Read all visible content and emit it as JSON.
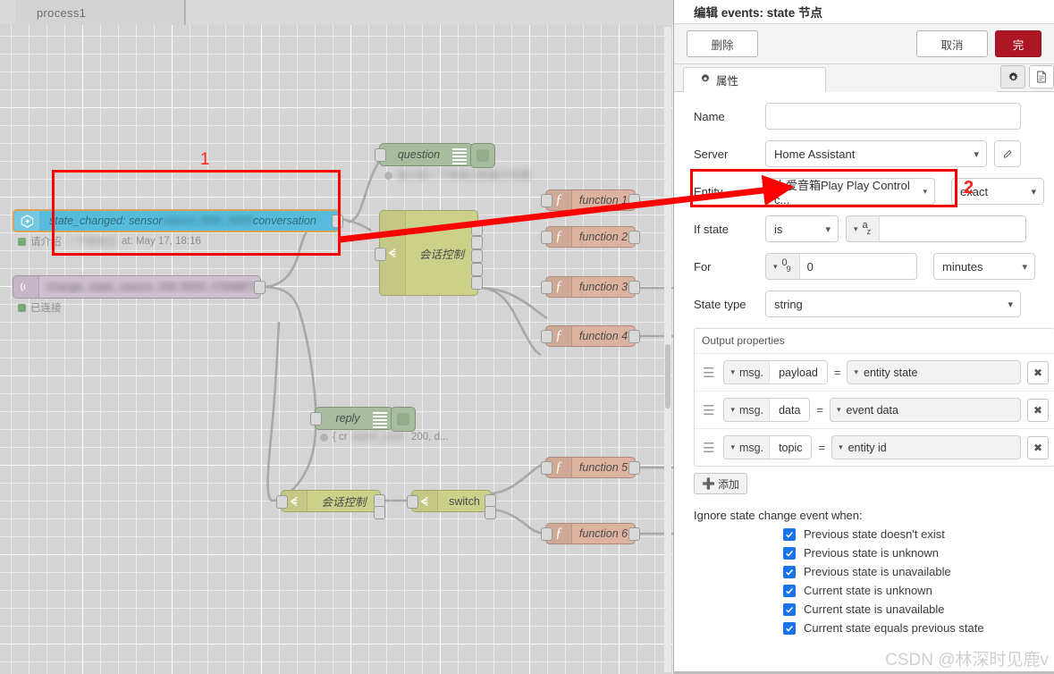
{
  "canvas": {
    "tab_label": "process1",
    "nodes": [
      {
        "id": "state_changed",
        "label": "state_changed: sensor_xiaomi_l05b_5655_conversation",
        "label_visible": "state_changed: sensor",
        "label_tail": "conversation",
        "status": "请介绍",
        "status_tail": "at: May 17, 18:16",
        "type": "events-state",
        "selected": true
      },
      {
        "id": "mqtt_reply",
        "label": "ch...reply",
        "label_tail": "'reply",
        "status": "已连接",
        "type": "mqtt-in"
      },
      {
        "id": "question",
        "label": "question",
        "status": "",
        "type": "ui-template"
      },
      {
        "id": "switch_top",
        "label": "会话控制",
        "type": "switch"
      },
      {
        "id": "reply",
        "label": "reply",
        "status": "{ cr",
        "status_tail": "200, d...",
        "type": "ui-template"
      },
      {
        "id": "switch_bottom",
        "label": "会话控制",
        "type": "switch"
      },
      {
        "id": "switch_mid",
        "label": "switch",
        "type": "switch"
      },
      {
        "id": "function1",
        "label": "function 1",
        "type": "function"
      },
      {
        "id": "function2",
        "label": "function 2",
        "type": "function"
      },
      {
        "id": "function3",
        "label": "function 3",
        "type": "function"
      },
      {
        "id": "function4",
        "label": "function 4",
        "type": "function"
      },
      {
        "id": "function5",
        "label": "function 5",
        "type": "function"
      },
      {
        "id": "function6",
        "label": "function 6",
        "type": "function"
      }
    ]
  },
  "dialog": {
    "title": "编辑 events: state 节点",
    "toolbar": {
      "delete": "删除",
      "cancel": "取消",
      "done": "完"
    },
    "tabs": {
      "properties": "属性",
      "gear_icon": "gear-icon",
      "doc_icon": "document-icon"
    },
    "form": {
      "name_label": "Name",
      "name_value": "",
      "name_placeholder": "",
      "server_label": "Server",
      "server_value": "Home Assistant",
      "entity_label": "Entity",
      "entity_value": "小爱音箱Play Play Control c...",
      "entity_match": "exact",
      "ifstate_label": "If state",
      "ifstate_op": "is",
      "ifstate_type": "az",
      "ifstate_value": "",
      "for_label": "For",
      "for_type": "09",
      "for_value": "0",
      "for_unit": "minutes",
      "statetype_label": "State type",
      "statetype_value": "string"
    },
    "output_properties": {
      "title": "Output properties",
      "rows": [
        {
          "prefix": "msg.",
          "key": "payload",
          "eq": "=",
          "value": "entity state",
          "remove": "✖"
        },
        {
          "prefix": "msg.",
          "key": "data",
          "eq": "=",
          "value": "event data",
          "remove": "✖"
        },
        {
          "prefix": "msg.",
          "key": "topic",
          "eq": "=",
          "value": "entity id",
          "remove": "✖"
        }
      ],
      "add_label": "添加"
    },
    "ignore": {
      "title": "Ignore state change event when:",
      "items": [
        {
          "label": "Previous state doesn't exist",
          "checked": true
        },
        {
          "label": "Previous state is unknown",
          "checked": true
        },
        {
          "label": "Previous state is unavailable",
          "checked": true
        },
        {
          "label": "Current state is unknown",
          "checked": true
        },
        {
          "label": "Current state is unavailable",
          "checked": true
        },
        {
          "label": "Current state equals previous state",
          "checked": true
        }
      ]
    }
  },
  "annotations": {
    "marker_1": "1",
    "marker_2": "2",
    "color": "#ff0000"
  },
  "watermark": "CSDN @林深时见鹿v"
}
